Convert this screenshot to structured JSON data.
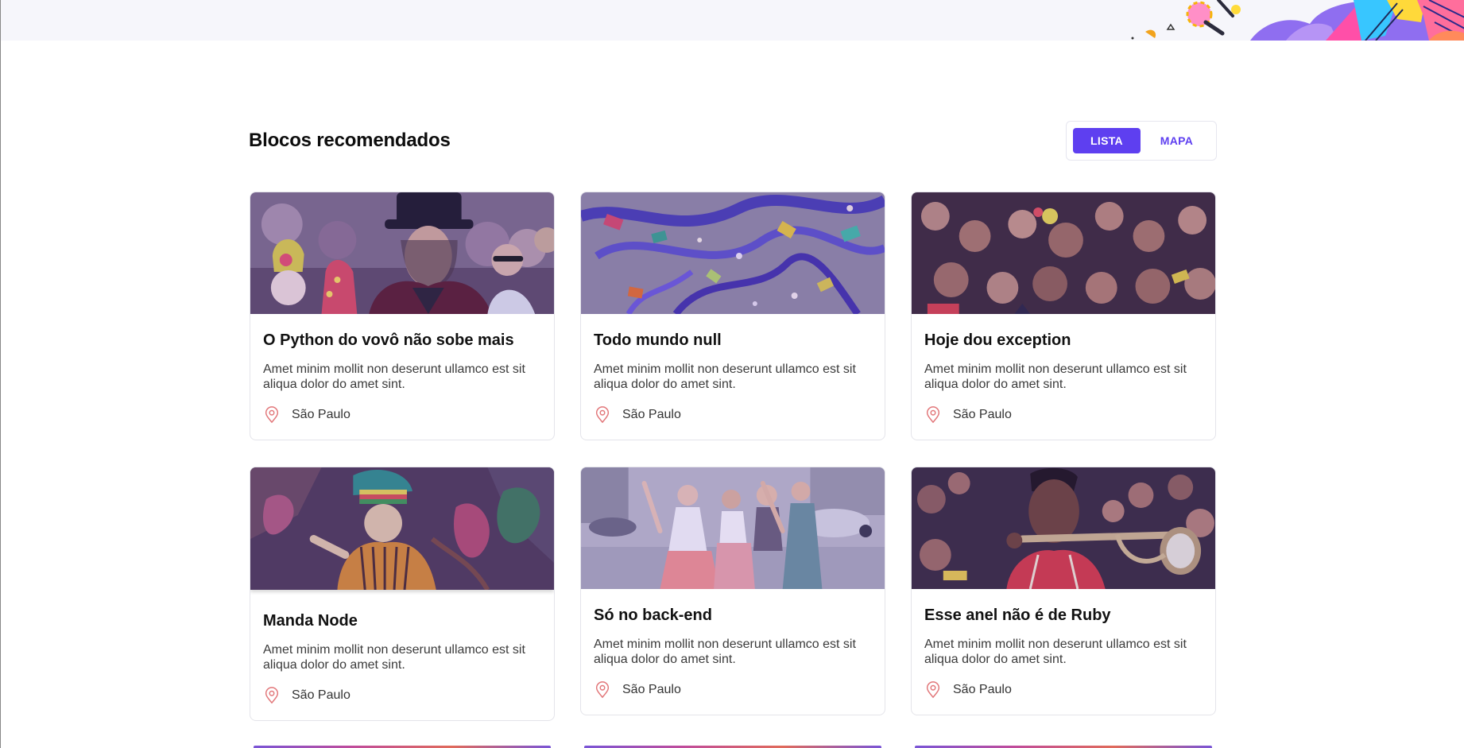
{
  "section": {
    "title": "Blocos recomendados",
    "toggle": {
      "list_label": "LISTA",
      "map_label": "MAPA",
      "selected": "LISTA"
    }
  },
  "cards": [
    {
      "title": "O Python do vovô não sobe mais",
      "description": "Amet minim mollit non deserunt ullamco est sit aliqua dolor do amet sint.",
      "location": "São Paulo",
      "image": "carnival-crowd-top-hat-man"
    },
    {
      "title": "Todo mundo null",
      "description": "Amet minim mollit non deserunt ullamco est sit aliqua dolor do amet sint.",
      "location": "São Paulo",
      "image": "confetti-streamers-floor"
    },
    {
      "title": "Hoje dou exception",
      "description": "Amet minim mollit non deserunt ullamco est sit aliqua dolor do amet sint.",
      "location": "São Paulo",
      "image": "dense-party-crowd"
    },
    {
      "title": "Manda Node",
      "description": "Amet minim mollit non deserunt ullamco est sit aliqua dolor do amet sint.",
      "location": "São Paulo",
      "image": "feathered-costume-dancer"
    },
    {
      "title": "Só no back-end",
      "description": "Amet minim mollit non deserunt ullamco est sit aliqua dolor do amet sint.",
      "location": "São Paulo",
      "image": "group-dancing-street"
    },
    {
      "title": "Esse anel não é de Ruby",
      "description": "Amet minim mollit non deserunt ullamco est sit aliqua dolor do amet sint.",
      "location": "São Paulo",
      "image": "trumpet-player-crowd"
    }
  ],
  "colors": {
    "accent": "#5e3ff0",
    "pin": "#e2777a",
    "overlay": "#5b3fd8"
  },
  "icons": {
    "location": "map-pin-icon"
  }
}
